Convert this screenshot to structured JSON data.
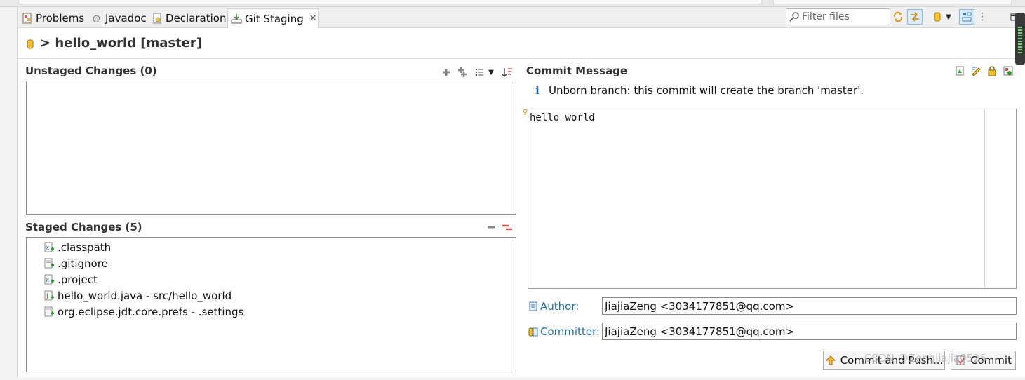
{
  "tabs": [
    {
      "label": "Problems",
      "icon": "problems-icon"
    },
    {
      "label": "Javadoc",
      "icon": "javadoc-icon"
    },
    {
      "label": "Declaration",
      "icon": "declaration-icon"
    },
    {
      "label": "Git Staging",
      "icon": "git-staging-icon",
      "active": true
    }
  ],
  "toolbar": {
    "filter_placeholder": "Filter files"
  },
  "repo_header": {
    "title": "> hello_world [master]"
  },
  "unstaged": {
    "title": "Unstaged Changes (0)",
    "files": []
  },
  "staged": {
    "title": "Staged Changes (5)",
    "files": [
      ".classpath",
      ".gitignore",
      ".project",
      "hello_world.java - src/hello_world",
      "org.eclipse.jdt.core.prefs - .settings"
    ]
  },
  "commit": {
    "title": "Commit Message",
    "info": "Unborn branch: this commit will create the branch 'master'.",
    "message": "hello_world",
    "author_label": "Author:",
    "author_value": "JiajiaZeng <3034177851@qq.com>",
    "committer_label": "Committer:",
    "committer_value": "JiajiaZeng <3034177851@qq.com>",
    "commit_push_label": "Commit and Push...",
    "commit_label": "Commit"
  },
  "watermark": "CSDN @Zengjiajia0525",
  "colors": {
    "link_blue": "#1f6fb5",
    "border": "#8a8a8a"
  }
}
